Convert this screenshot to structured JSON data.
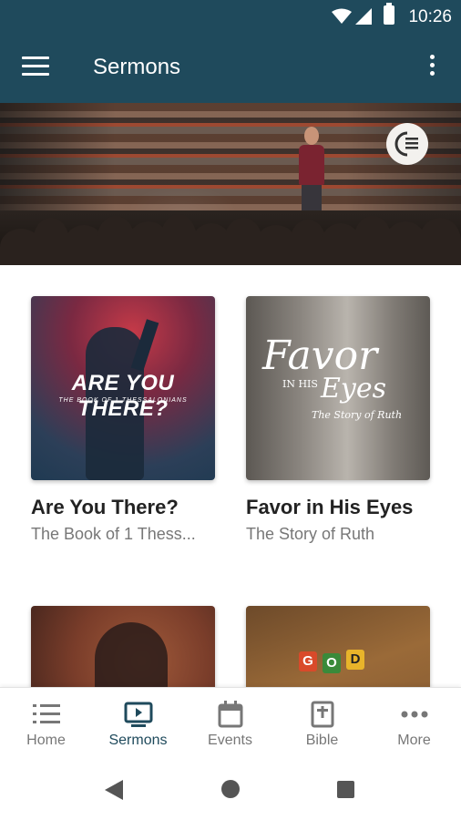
{
  "status_bar": {
    "time": "10:26"
  },
  "app_bar": {
    "title": "Sermons"
  },
  "sermons": [
    {
      "title": "Are You There?",
      "subtitle": "The Book of 1 Thess...",
      "art_title": "ARE YOU THERE?",
      "art_subtitle": "THE BOOK OF 1 THESSALONIANS"
    },
    {
      "title": "Favor in His Eyes",
      "subtitle": "The Story of Ruth",
      "art_title": "Favor",
      "art_in": "IN HIS",
      "art_eyes": "Eyes",
      "art_subtitle": "The Story of Ruth"
    },
    {
      "title": "",
      "subtitle": ""
    },
    {
      "title": "",
      "subtitle": "",
      "art_letters": [
        "G",
        "O",
        "D"
      ]
    }
  ],
  "bottom_nav": [
    {
      "label": "Home",
      "icon": "list-icon"
    },
    {
      "label": "Sermons",
      "icon": "video-icon",
      "active": true
    },
    {
      "label": "Events",
      "icon": "calendar-icon"
    },
    {
      "label": "Bible",
      "icon": "bible-icon"
    },
    {
      "label": "More",
      "icon": "more-dots-icon"
    }
  ],
  "colors": {
    "primary": "#1f4a5c",
    "inactive": "#777777"
  }
}
